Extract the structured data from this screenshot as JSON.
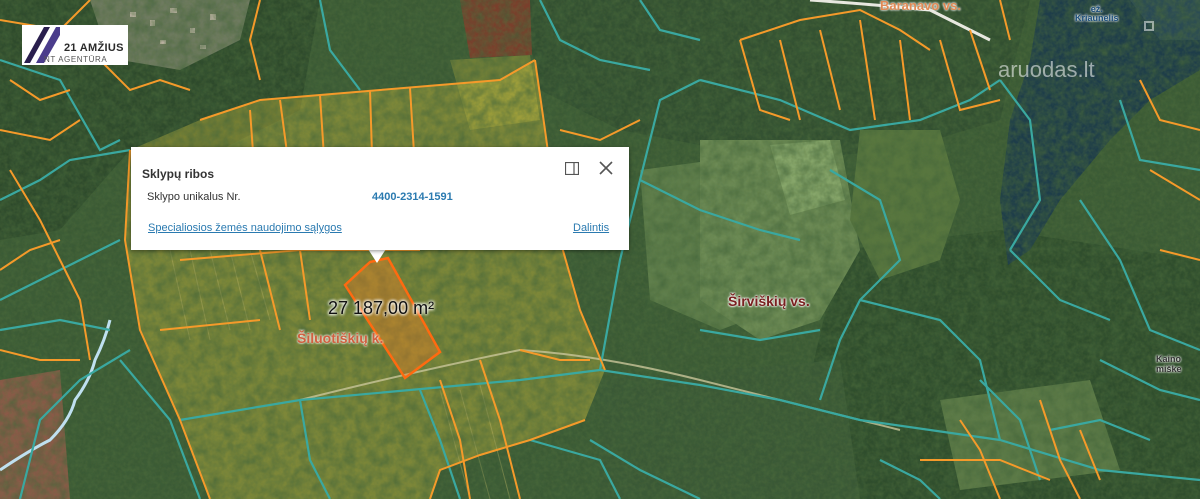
{
  "map": {
    "plot_area_label": "27 187,00 m²",
    "place_labels": {
      "baranavo": "Baranavo vs.",
      "ez_line1": "ež.",
      "ez_line2": "Kriaunelis",
      "siriskiu": "Širviškių vs.",
      "siluotiskiu": "Šiluotiškių k.",
      "kaino_line1": "Kaino",
      "kaino_line2": "miške"
    },
    "colors": {
      "parcel_line_orange": "#f59a2a",
      "parcel_line_teal": "#3aa8a0",
      "selected_plot": "#ff6a10",
      "highlight_zone": "#d8c640",
      "lake": "#1e3d4a"
    }
  },
  "logo": {
    "title": "21 AMŽIUS",
    "subtitle": "NT AGENTŪRA"
  },
  "watermark": "aruodas.lt",
  "popup": {
    "title": "Sklypų ribos",
    "field_label": "Sklypo unikalus Nr.",
    "field_value": "4400-2314-1591",
    "special_link": "Specialiosios žemės naudojimo sąlygos",
    "share_link": "Dalintis",
    "dock_icon": "dock-panel-icon",
    "close_icon": "close-icon"
  }
}
